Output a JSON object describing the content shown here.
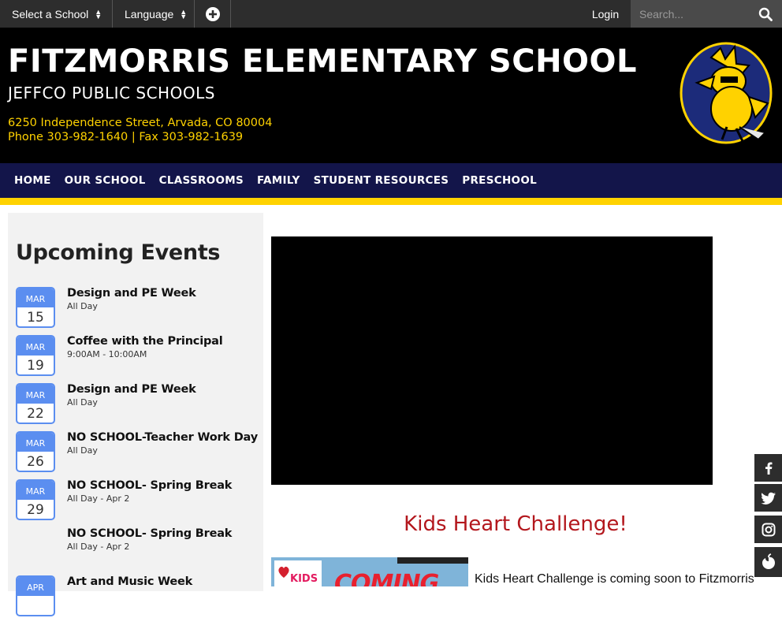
{
  "topbar": {
    "select_school": "Select a School",
    "language": "Language",
    "login": "Login",
    "search_placeholder": "Search..."
  },
  "header": {
    "school_name": "FITZMORRIS ELEMENTARY SCHOOL",
    "district": "JEFFCO PUBLIC SCHOOLS",
    "address": "6250 Independence Street, Arvada, CO 80004",
    "phone_fax": "Phone 303-982-1640 | Fax 303-982-1639"
  },
  "nav": {
    "items": [
      "HOME",
      "OUR SCHOOL",
      "CLASSROOMS",
      "FAMILY",
      "STUDENT RESOURCES",
      "PRESCHOOL"
    ]
  },
  "events": {
    "title": "Upcoming Events",
    "items": [
      {
        "month": "MAR",
        "day": "15",
        "title": "Design and PE Week",
        "time": "All Day"
      },
      {
        "month": "MAR",
        "day": "19",
        "title": "Coffee with the Principal",
        "time": "9:00AM - 10:00AM"
      },
      {
        "month": "MAR",
        "day": "22",
        "title": "Design and PE Week",
        "time": "All Day"
      },
      {
        "month": "MAR",
        "day": "26",
        "title": "NO SCHOOL-Teacher Work Day",
        "time": "All Day"
      },
      {
        "month": "MAR",
        "day": "29",
        "title": "NO SCHOOL- Spring Break",
        "time": "All Day - Apr 2"
      },
      {
        "month": "",
        "day": "",
        "title": "NO SCHOOL- Spring Break",
        "time": "All Day - Apr 2"
      },
      {
        "month": "APR",
        "day": "",
        "title": "Art and Music Week",
        "time": ""
      }
    ]
  },
  "main": {
    "kids_heading": "Kids Heart Challenge!",
    "kids_text": "Kids Heart Challenge is coming soon to Fitzmorris",
    "kids_image": {
      "badge": "KIDS",
      "banner": "COMING"
    }
  },
  "social": [
    "facebook-icon",
    "twitter-icon",
    "instagram-icon",
    "peachjar-icon"
  ],
  "colors": {
    "navy": "#13154a",
    "gold": "#ffd200",
    "accent_blue": "#5b8ef0",
    "heading_red": "#b3171d"
  }
}
